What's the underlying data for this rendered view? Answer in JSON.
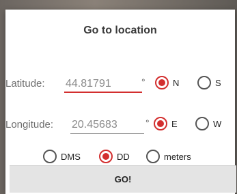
{
  "dialog": {
    "title": "Go to location"
  },
  "latitude": {
    "label": "Latitude:",
    "value": "44.81791",
    "degree_symbol": "°",
    "options": [
      {
        "label": "N",
        "selected": true
      },
      {
        "label": "S",
        "selected": false
      }
    ]
  },
  "longitude": {
    "label": "Longitude:",
    "value": "20.45683",
    "degree_symbol": "°",
    "options": [
      {
        "label": "E",
        "selected": true
      },
      {
        "label": "W",
        "selected": false
      }
    ]
  },
  "units": {
    "options": [
      {
        "label": "DMS",
        "selected": false
      },
      {
        "label": "DD",
        "selected": true
      },
      {
        "label": "meters",
        "selected": false
      }
    ]
  },
  "go_button": {
    "label": "GO!"
  },
  "colors": {
    "accent": "#d32f2f",
    "button_bg": "#e4e4e4"
  }
}
